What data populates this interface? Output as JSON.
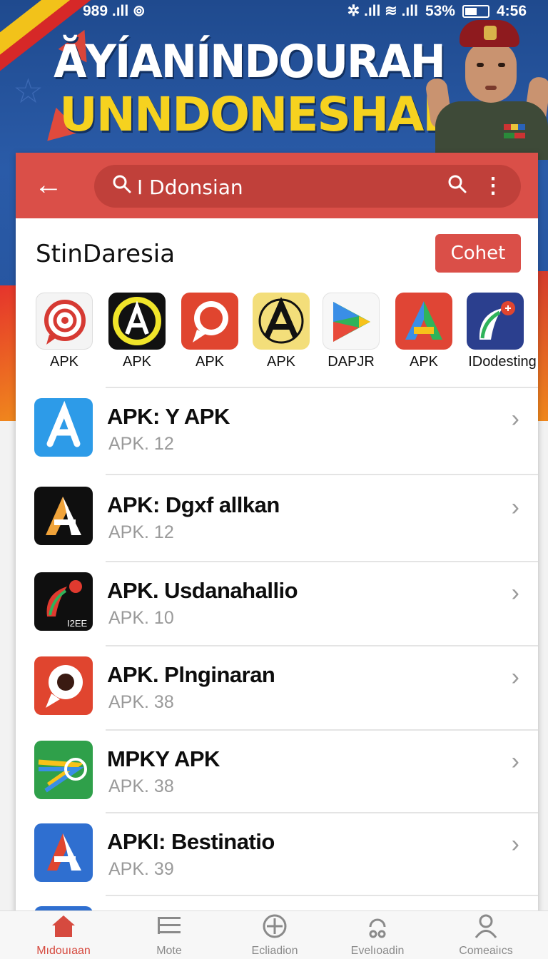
{
  "status_bar": {
    "left": "989 .ıll  ⊚",
    "right_signal": "✲ .ıll ≋ .ıll",
    "battery": "53%",
    "time": "4:56"
  },
  "banner": {
    "line1": "ĂΥÍANÍNDOURAH",
    "line2": "UNNDONESHAI"
  },
  "appbar": {
    "search_value": "I Ddonsian"
  },
  "section": {
    "title": "StinDaresia",
    "action_label": "Cohet"
  },
  "featured": [
    {
      "label": "APK",
      "icon": "target-chat-icon"
    },
    {
      "label": "APK",
      "icon": "a-badge-icon"
    },
    {
      "label": "APK",
      "icon": "chat-bubble-icon"
    },
    {
      "label": "APK",
      "icon": "a-triangle-icon"
    },
    {
      "label": "DAPJR",
      "icon": "play-store-icon"
    },
    {
      "label": "APK",
      "icon": "colorful-a-icon"
    },
    {
      "label": "IDodesting",
      "icon": "leaf-icon"
    }
  ],
  "apps": [
    {
      "title": "APK: Y APK",
      "subtitle": "APK. 12",
      "icon": "blue-a-icon"
    },
    {
      "title": "APK: Dgxf allkan",
      "subtitle": "APK. 12",
      "icon": "orange-a-icon"
    },
    {
      "title": "APK. Usdanahallio",
      "subtitle": "APK. 10",
      "icon": "leaf-dark-icon",
      "icon_text": "I2EE"
    },
    {
      "title": "APK. Plnginaran",
      "subtitle": "APK. 38",
      "icon": "red-bubble-icon"
    },
    {
      "title": "MPKY APK",
      "subtitle": "APK. 38",
      "icon": "green-arrow-icon"
    },
    {
      "title": "APKI: Bestinatio",
      "subtitle": "APK. 39",
      "icon": "red-blue-a-icon"
    }
  ],
  "bottom_nav": [
    {
      "label": "Mıdouıaan",
      "icon": "home-icon",
      "active": true
    },
    {
      "label": "Mote",
      "icon": "list-icon",
      "active": false
    },
    {
      "label": "Ecliadion",
      "icon": "plus-circle-icon",
      "active": false
    },
    {
      "label": "Evelıoadin",
      "icon": "download-icon",
      "active": false
    },
    {
      "label": "Comeaiıcs",
      "icon": "person-icon",
      "active": false
    }
  ],
  "colors": {
    "accent": "#da4f48",
    "banner_blue": "#24519a",
    "banner_yellow": "#f6d21f"
  }
}
